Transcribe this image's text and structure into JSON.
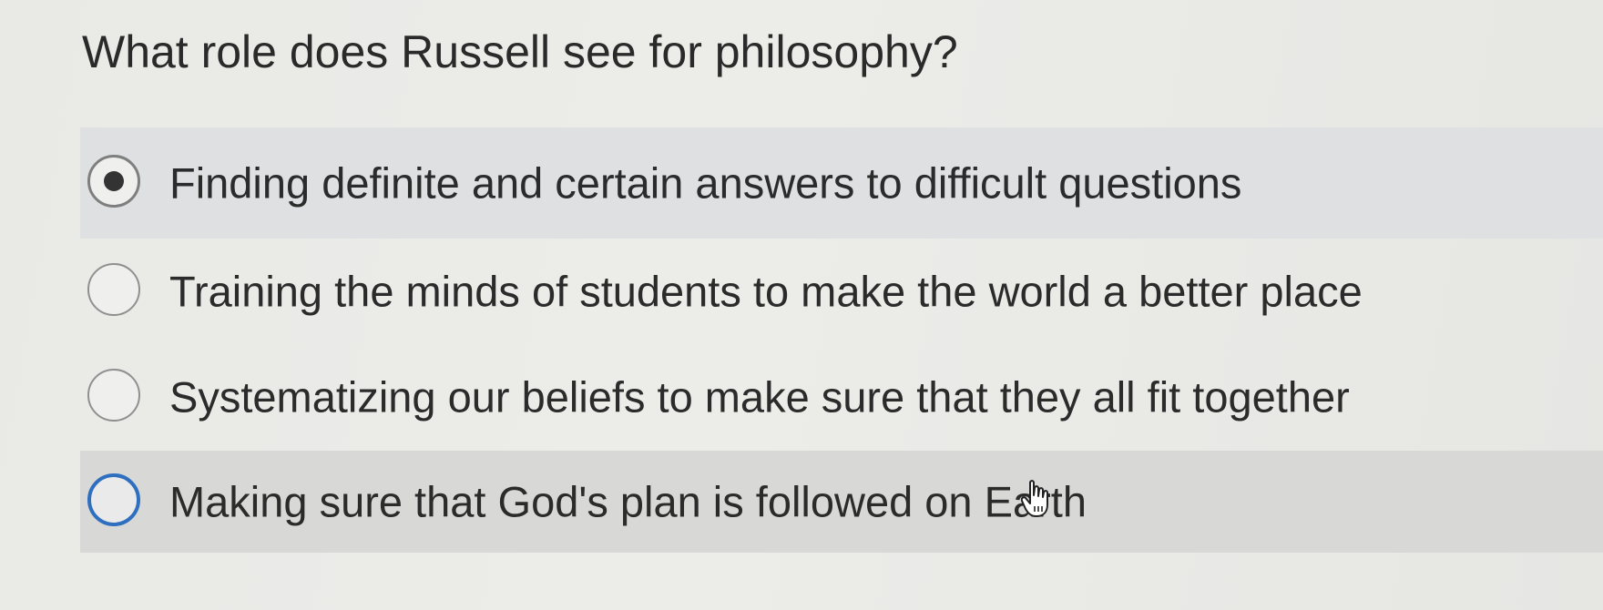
{
  "question": {
    "text": "What role does Russell see for philosophy?"
  },
  "options": [
    {
      "label": "Finding definite and certain answers to difficult questions",
      "selected": true
    },
    {
      "label": "Training the minds of students to make the world a better place",
      "selected": false
    },
    {
      "label": "Systematizing our beliefs to make sure that they all fit together",
      "selected": false
    },
    {
      "label": "Making sure that God's plan is followed on Earth",
      "selected": false,
      "hovered": true
    }
  ],
  "colors": {
    "hover_ring": "#2f6fc0",
    "selected_row": "#dee0e1",
    "hover_row": "#d8d8d6"
  },
  "icons": {
    "cursor": "hand-pointer-icon"
  }
}
